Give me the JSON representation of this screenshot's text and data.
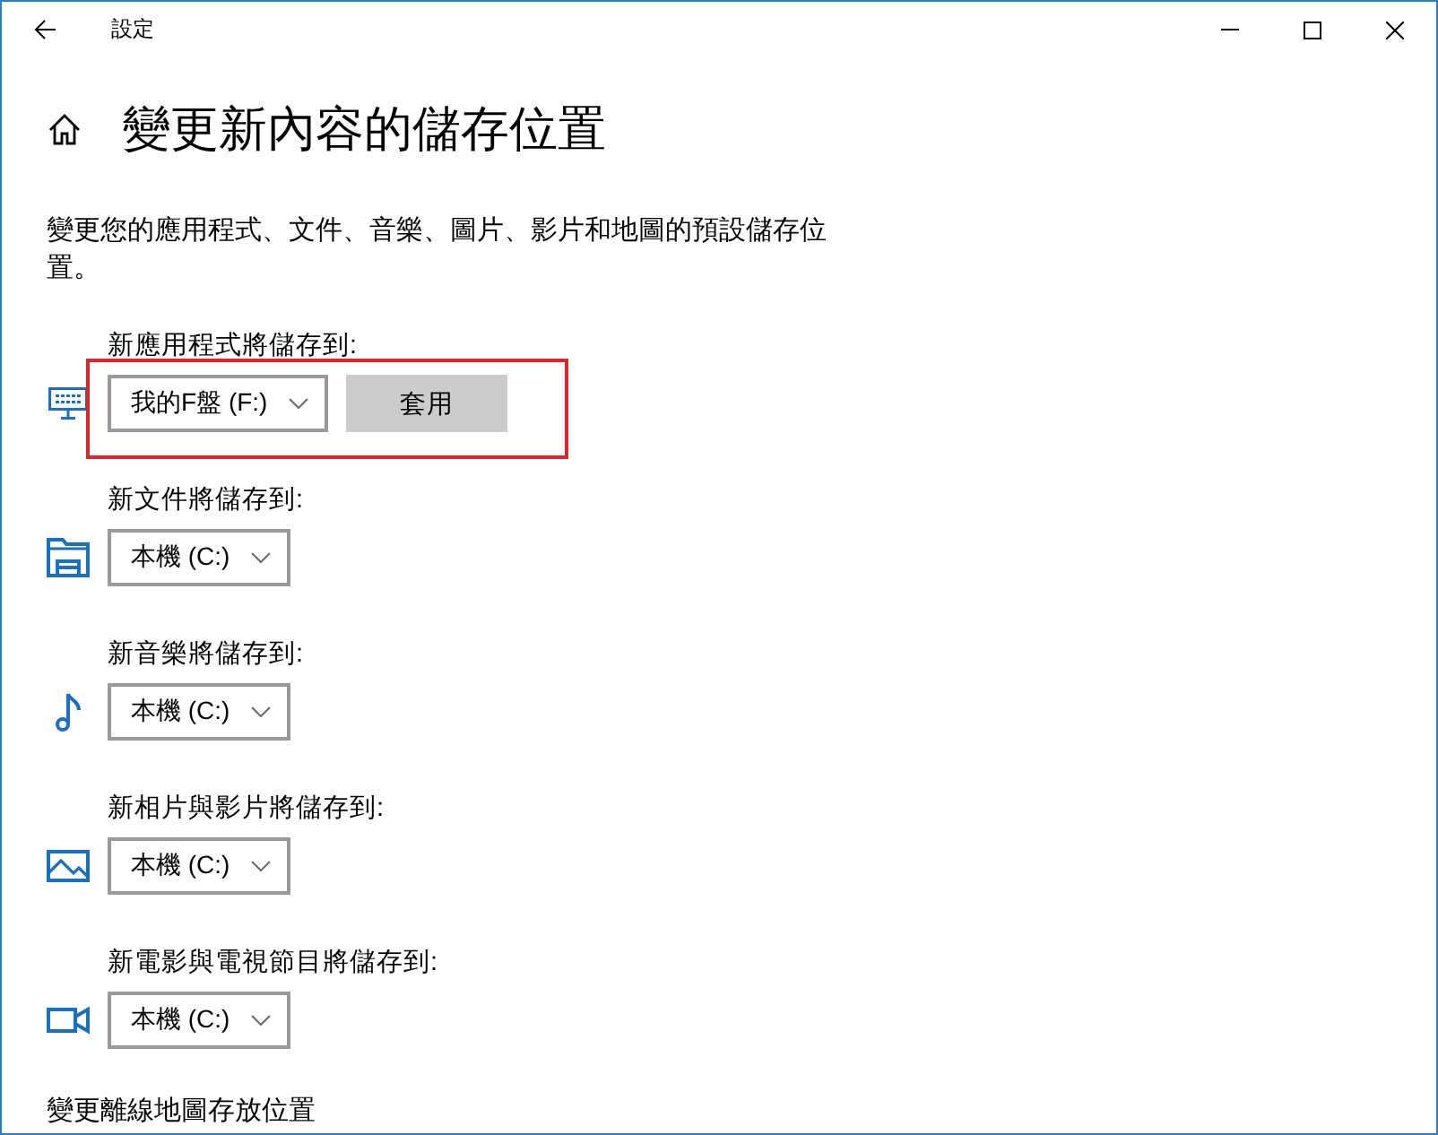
{
  "window": {
    "title": "設定"
  },
  "page": {
    "title": "變更新內容的儲存位置",
    "description": "變更您的應用程式、文件、音樂、圖片、影片和地圖的預設儲存位置。"
  },
  "locations": [
    {
      "kind": "apps",
      "label": "新應用程式將儲存到:",
      "value": "我的F盤 (F:)",
      "apply_button": "套用",
      "highlighted": true
    },
    {
      "kind": "documents",
      "label": "新文件將儲存到:",
      "value": "本機 (C:)",
      "highlighted": false
    },
    {
      "kind": "music",
      "label": "新音樂將儲存到:",
      "value": "本機 (C:)",
      "highlighted": false
    },
    {
      "kind": "photos",
      "label": "新相片與影片將儲存到:",
      "value": "本機 (C:)",
      "highlighted": false
    },
    {
      "kind": "movies",
      "label": "新電影與電視節目將儲存到:",
      "value": "本機 (C:)",
      "highlighted": false
    }
  ],
  "offline_maps": {
    "label": "變更離線地圖存放位置"
  }
}
